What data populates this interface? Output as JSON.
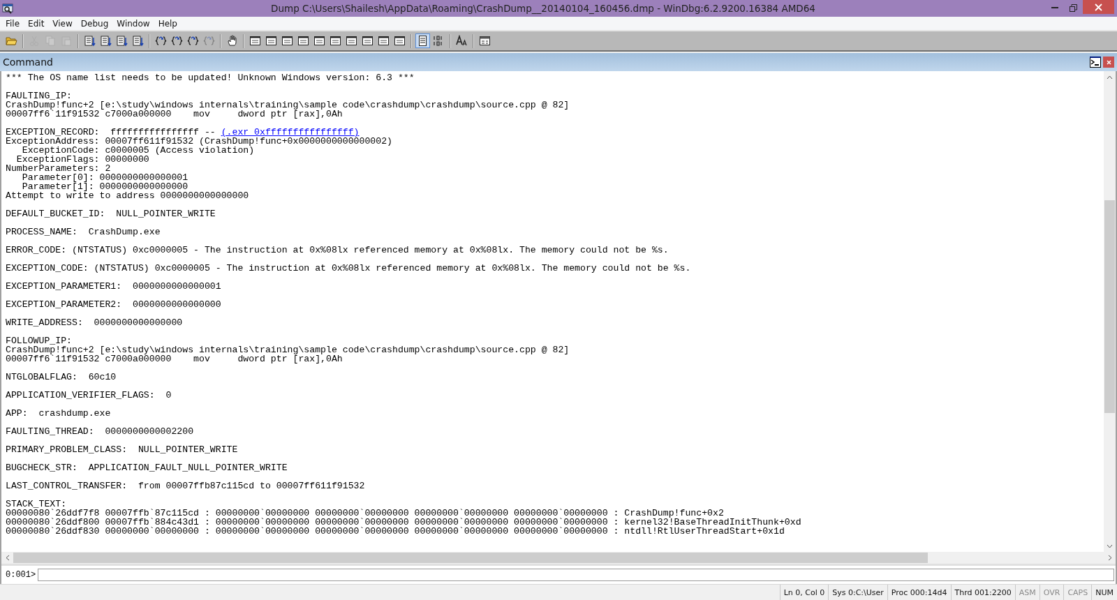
{
  "window": {
    "title": "Dump C:\\Users\\Shailesh\\AppData\\Roaming\\CrashDump__20140104_160456.dmp - WinDbg:6.2.9200.16384 AMD64"
  },
  "menu": [
    "File",
    "Edit",
    "View",
    "Debug",
    "Window",
    "Help"
  ],
  "toolbar": [
    {
      "kind": "open",
      "disabled": false,
      "selected": false
    },
    {
      "kind": "sep"
    },
    {
      "kind": "cut",
      "disabled": true,
      "selected": false
    },
    {
      "kind": "copy",
      "disabled": true,
      "selected": false
    },
    {
      "kind": "paste",
      "disabled": true,
      "selected": false
    },
    {
      "kind": "sep"
    },
    {
      "kind": "lines",
      "disabled": false,
      "selected": false
    },
    {
      "kind": "lines",
      "disabled": false,
      "selected": false
    },
    {
      "kind": "lines",
      "disabled": false,
      "selected": false
    },
    {
      "kind": "lines",
      "disabled": false,
      "selected": false
    },
    {
      "kind": "sep"
    },
    {
      "kind": "brace",
      "disabled": false,
      "selected": false
    },
    {
      "kind": "brace",
      "disabled": false,
      "selected": false
    },
    {
      "kind": "brace",
      "disabled": false,
      "selected": false
    },
    {
      "kind": "brace",
      "disabled": true,
      "selected": false
    },
    {
      "kind": "sep"
    },
    {
      "kind": "hand",
      "disabled": false,
      "selected": false
    },
    {
      "kind": "sep"
    },
    {
      "kind": "window",
      "disabled": false,
      "selected": false
    },
    {
      "kind": "window",
      "disabled": false,
      "selected": false
    },
    {
      "kind": "window",
      "disabled": false,
      "selected": false
    },
    {
      "kind": "window",
      "disabled": false,
      "selected": false
    },
    {
      "kind": "window",
      "disabled": false,
      "selected": false
    },
    {
      "kind": "window",
      "disabled": false,
      "selected": false
    },
    {
      "kind": "window",
      "disabled": false,
      "selected": false
    },
    {
      "kind": "window",
      "disabled": false,
      "selected": false
    },
    {
      "kind": "window",
      "disabled": false,
      "selected": false
    },
    {
      "kind": "window",
      "disabled": false,
      "selected": false
    },
    {
      "kind": "sep"
    },
    {
      "kind": "source",
      "disabled": false,
      "selected": true
    },
    {
      "kind": "binary",
      "disabled": false,
      "selected": false
    },
    {
      "kind": "sep"
    },
    {
      "kind": "font",
      "disabled": false,
      "selected": false
    },
    {
      "kind": "sep"
    },
    {
      "kind": "options",
      "disabled": false,
      "selected": false
    }
  ],
  "command_window": {
    "title": "Command",
    "blocks": [
      [
        {
          "text": "*** The OS name list needs to be updated! Unknown Windows version: 6.3 ***"
        }
      ],
      [
        {
          "text": "FAULTING_IP: "
        },
        {
          "text": "CrashDump!func+2 [e:\\study\\windows internals\\training\\sample code\\crashdump\\crashdump\\source.cpp @ 82]"
        },
        {
          "text": "00007ff6`11f91532 c7000a000000    mov     dword ptr [rax],0Ah"
        }
      ],
      [
        {
          "text": "EXCEPTION_RECORD:  ffffffffffffffff -- ",
          "link": "(.exr 0xffffffffffffffff)"
        },
        {
          "text": "ExceptionAddress: 00007ff611f91532 (CrashDump!func+0x0000000000000002)"
        },
        {
          "text": "   ExceptionCode: c0000005 (Access violation)"
        },
        {
          "text": "  ExceptionFlags: 00000000"
        },
        {
          "text": "NumberParameters: 2"
        },
        {
          "text": "   Parameter[0]: 0000000000000001"
        },
        {
          "text": "   Parameter[1]: 0000000000000000"
        },
        {
          "text": "Attempt to write to address 0000000000000000"
        }
      ],
      [
        {
          "text": "DEFAULT_BUCKET_ID:  NULL_POINTER_WRITE"
        }
      ],
      [
        {
          "text": "PROCESS_NAME:  CrashDump.exe"
        }
      ],
      [
        {
          "text": "ERROR_CODE: (NTSTATUS) 0xc0000005 - The instruction at 0x%08lx referenced memory at 0x%08lx. The memory could not be %s."
        }
      ],
      [
        {
          "text": "EXCEPTION_CODE: (NTSTATUS) 0xc0000005 - The instruction at 0x%08lx referenced memory at 0x%08lx. The memory could not be %s."
        }
      ],
      [
        {
          "text": "EXCEPTION_PARAMETER1:  0000000000000001"
        }
      ],
      [
        {
          "text": "EXCEPTION_PARAMETER2:  0000000000000000"
        }
      ],
      [
        {
          "text": "WRITE_ADDRESS:  0000000000000000 "
        }
      ],
      [
        {
          "text": "FOLLOWUP_IP: "
        },
        {
          "text": "CrashDump!func+2 [e:\\study\\windows internals\\training\\sample code\\crashdump\\crashdump\\source.cpp @ 82]"
        },
        {
          "text": "00007ff6`11f91532 c7000a000000    mov     dword ptr [rax],0Ah"
        }
      ],
      [
        {
          "text": "NTGLOBALFLAG:  60c10"
        }
      ],
      [
        {
          "text": "APPLICATION_VERIFIER_FLAGS:  0"
        }
      ],
      [
        {
          "text": "APP:  crashdump.exe"
        }
      ],
      [
        {
          "text": "FAULTING_THREAD:  0000000000002200"
        }
      ],
      [
        {
          "text": "PRIMARY_PROBLEM_CLASS:  NULL_POINTER_WRITE"
        }
      ],
      [
        {
          "text": "BUGCHECK_STR:  APPLICATION_FAULT_NULL_POINTER_WRITE"
        }
      ],
      [
        {
          "text": "LAST_CONTROL_TRANSFER:  from 00007ffb87c115cd to 00007ff611f91532"
        }
      ],
      [
        {
          "text": "STACK_TEXT:  "
        },
        {
          "text": "00000080`26ddf7f8 00007ffb`87c115cd : 00000000`00000000 00000000`00000000 00000000`00000000 00000000`00000000 : CrashDump!func+0x2"
        },
        {
          "text": "00000080`26ddf800 00007ffb`884c43d1 : 00000000`00000000 00000000`00000000 00000000`00000000 00000000`00000000 : kernel32!BaseThreadInitThunk+0xd"
        },
        {
          "text": "00000080`26ddf830 00000000`00000000 : 00000000`00000000 00000000`00000000 00000000`00000000 00000000`00000000 : ntdll!RtlUserThreadStart+0x1d"
        }
      ]
    ],
    "prompt": "0:001>"
  },
  "status_bar": [
    {
      "text": "Ln 0, Col 0",
      "disabled": false
    },
    {
      "text": "Sys 0:C:\\User",
      "disabled": false
    },
    {
      "text": "Proc 000:14d4",
      "disabled": false
    },
    {
      "text": "Thrd 001:2200",
      "disabled": false
    },
    {
      "text": "ASM",
      "disabled": true
    },
    {
      "text": "OVR",
      "disabled": true
    },
    {
      "text": "CAPS",
      "disabled": true
    },
    {
      "text": "NUM",
      "disabled": false
    }
  ]
}
